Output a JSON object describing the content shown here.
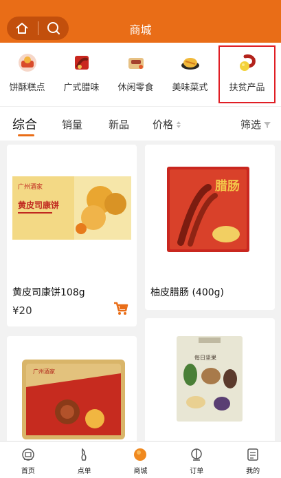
{
  "header": {
    "title": "商城"
  },
  "categories": [
    {
      "label": "饼酥糕点",
      "icon": "pastry-icon",
      "selected": false
    },
    {
      "label": "广式腊味",
      "icon": "sausage-icon",
      "selected": false
    },
    {
      "label": "休闲零食",
      "icon": "snack-icon",
      "selected": false
    },
    {
      "label": "美味菜式",
      "icon": "dish-icon",
      "selected": false
    },
    {
      "label": "扶贫产品",
      "icon": "poverty-aid-icon",
      "selected": true
    }
  ],
  "sort": {
    "comprehensive": "综合",
    "sales": "销量",
    "new": "新品",
    "price": "价格",
    "filter": "筛选"
  },
  "products": [
    {
      "name": "黄皮司康饼108g",
      "price": "¥20",
      "img_brand": "广州酒家",
      "img_title": "黄皮司康饼"
    },
    {
      "name": "柚皮腊肠 (400g)",
      "img_title": "腊肠"
    },
    {
      "img_brand": "广州酒家",
      "img_title": ""
    },
    {
      "img_title": "每日坚果"
    }
  ],
  "tabbar": [
    {
      "label": "首页",
      "icon": "home-icon"
    },
    {
      "label": "点单",
      "icon": "order-food-icon"
    },
    {
      "label": "商城",
      "icon": "mall-icon",
      "active": true
    },
    {
      "label": "订单",
      "icon": "orders-icon"
    },
    {
      "label": "我的",
      "icon": "profile-icon"
    }
  ],
  "colors": {
    "brand": "#e96d17",
    "brand_dark": "#c24f0c",
    "highlight": "#e01e24"
  }
}
